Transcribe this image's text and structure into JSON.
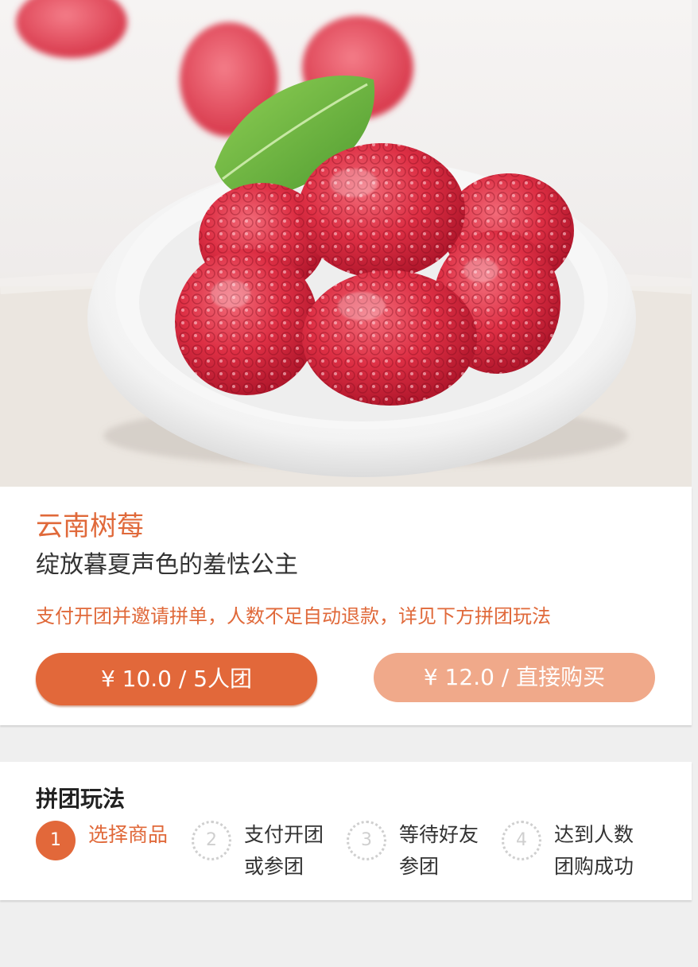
{
  "product": {
    "name": "云南树莓",
    "subtitle": "绽放暮夏声色的羞怯公主",
    "group_notice": "支付开团并邀请拼单，人数不足自动退款，详见下方拼团玩法"
  },
  "buttons": {
    "group_buy": "¥ 10.0 / 5人团",
    "direct_buy": "¥ 12.0 / 直接购买"
  },
  "rules": {
    "title": "拼团玩法",
    "steps": [
      {
        "num": "1",
        "line1": "选择商品",
        "line2": "",
        "active": true
      },
      {
        "num": "2",
        "line1": "支付开团",
        "line2": "或参团",
        "active": false
      },
      {
        "num": "3",
        "line1": "等待好友",
        "line2": "参团",
        "active": false
      },
      {
        "num": "4",
        "line1": "达到人数",
        "line2": "团购成功",
        "active": false
      }
    ]
  },
  "colors": {
    "accent": "#e2683a",
    "accent_light": "#f0a98a",
    "page_bg": "#efefef"
  }
}
